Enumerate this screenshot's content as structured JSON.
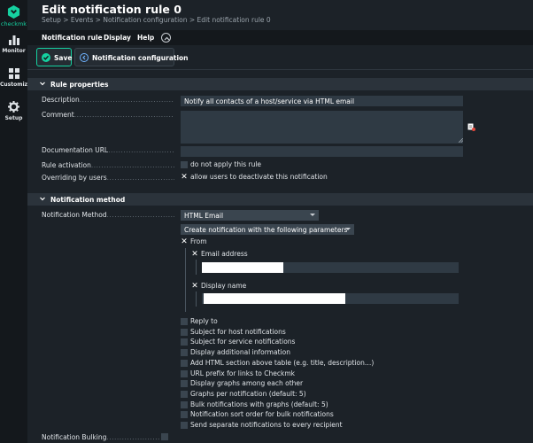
{
  "sidebar": {
    "logo_text": "checkmk",
    "items": [
      {
        "label": "Monitor",
        "icon": "monitor-icon"
      },
      {
        "label": "Customize",
        "icon": "customize-icon"
      },
      {
        "label": "Setup",
        "icon": "setup-icon"
      }
    ]
  },
  "header": {
    "title": "Edit notification rule 0",
    "breadcrumb": "Setup > Events > Notification configuration > Edit notification rule 0"
  },
  "menubar": {
    "items": [
      "Notification rule",
      "Display",
      "Help"
    ]
  },
  "toolbar": {
    "save_label": "Save",
    "notification_config_label": "Notification configuration"
  },
  "rule_properties": {
    "title": "Rule properties",
    "description_label": "Description",
    "description_value": "Notify all contacts of a host/service via HTML email",
    "comment_label": "Comment",
    "comment_value": "",
    "doc_url_label": "Documentation URL",
    "doc_url_value": "",
    "rule_activation_label": "Rule activation",
    "rule_activation_option": "do not apply this rule",
    "overriding_label": "Overriding by users",
    "overriding_option": "allow users to deactivate this notification"
  },
  "notification_method": {
    "title": "Notification method",
    "method_label": "Notification Method",
    "method_value": "HTML Email",
    "mode_value": "Create notification with the following parameters",
    "from_label": "From",
    "email_address_label": "Email address",
    "display_name_label": "Display name",
    "options": [
      "Reply to",
      "Subject for host notifications",
      "Subject for service notifications",
      "Display additional information",
      "Add HTML section above table (e.g. title, description…)",
      "URL prefix for links to Checkmk",
      "Display graphs among each other",
      "Graphs per notification (default: 5)",
      "Bulk notifications with graphs (default: 5)",
      "Notification sort order for bulk notifications",
      "Send separate notifications to every recipient"
    ],
    "bulking_label": "Notification Bulking"
  },
  "colors": {
    "accent": "#15d1a0",
    "background": "#1c2228",
    "sidebar": "#14181c",
    "field": "#2f3a44"
  }
}
